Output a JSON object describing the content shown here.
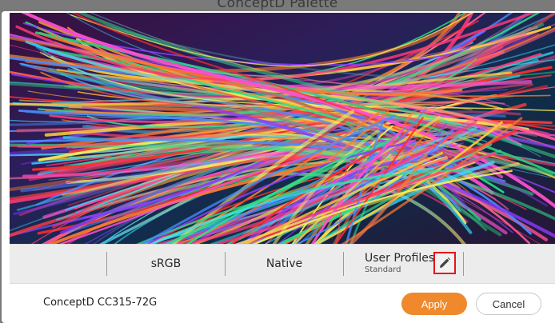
{
  "window": {
    "title": "ConceptD Palette"
  },
  "profiles": {
    "srgb_label": "sRGB",
    "native_label": "Native",
    "user_profiles_label": "User Profiles",
    "user_profiles_current": "Standard",
    "edit_icon": "pencil-icon"
  },
  "footer": {
    "device_name": "ConceptD CC315-72G",
    "apply_label": "Apply",
    "cancel_label": "Cancel"
  },
  "colors": {
    "accent": "#f0892c",
    "highlight_box": "#e4151b"
  }
}
